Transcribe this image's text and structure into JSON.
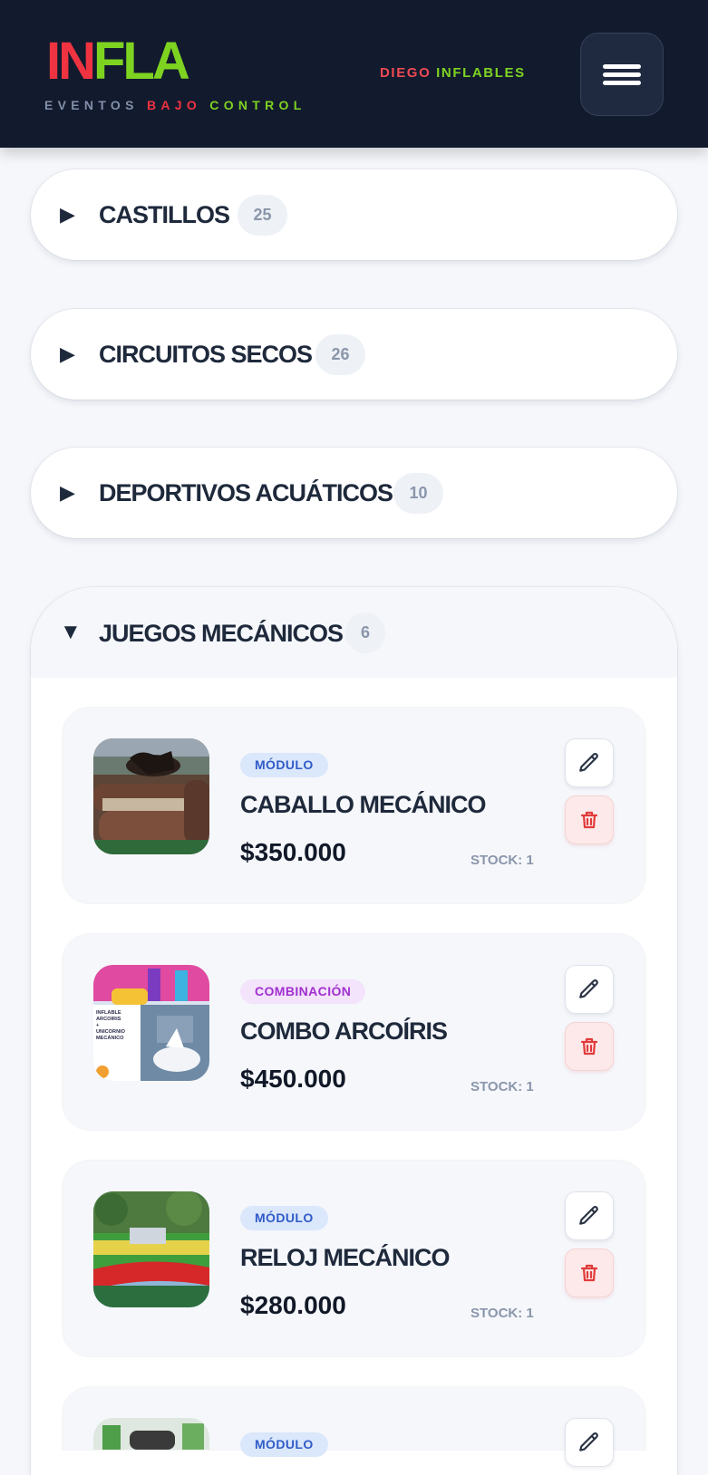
{
  "header": {
    "logo_red": "IN",
    "logo_green": "FLA",
    "tagline_1": "EVENTOS",
    "tagline_2": "BAJO",
    "tagline_3": "CONTROL",
    "brand_1": "DIEGO",
    "brand_2": "INFLABLES",
    "menu_icon": "hamburger-icon"
  },
  "categories": [
    {
      "title": "CASTILLOS",
      "count": "25",
      "expanded": false
    },
    {
      "title": "CIRCUITOS SECOS",
      "count": "26",
      "expanded": false
    },
    {
      "title": "DEPORTIVOS ACUÁTICOS",
      "count": "10",
      "expanded": false
    },
    {
      "title": "JUEGOS MECÁNICOS",
      "count": "6",
      "expanded": true
    }
  ],
  "arrows": {
    "collapsed": "▶",
    "expanded": "▼"
  },
  "items": [
    {
      "type": "MÓDULO",
      "name": "CABALLO MECÁNICO",
      "price": "$350.000",
      "stock": "STOCK: 1"
    },
    {
      "type": "COMBINACIÓN",
      "name": "COMBO ARCOÍRIS",
      "price": "$450.000",
      "stock": "STOCK: 1",
      "image_text": [
        "INFLABLE",
        "ARCOIRIS",
        "+",
        "UNICORNIO",
        "MECÁNICO"
      ]
    },
    {
      "type": "MÓDULO",
      "name": "RELOJ MECÁNICO",
      "price": "$280.000",
      "stock": "STOCK: 1"
    },
    {
      "type": "MÓDULO"
    }
  ],
  "colors": {
    "header_bg": "#121a2e",
    "logo_red": "#ef3340",
    "logo_green": "#7ed321",
    "page_bg": "#f5f7fb",
    "delete_bg": "#fde9e9",
    "delete_icon": "#e23b3b"
  }
}
